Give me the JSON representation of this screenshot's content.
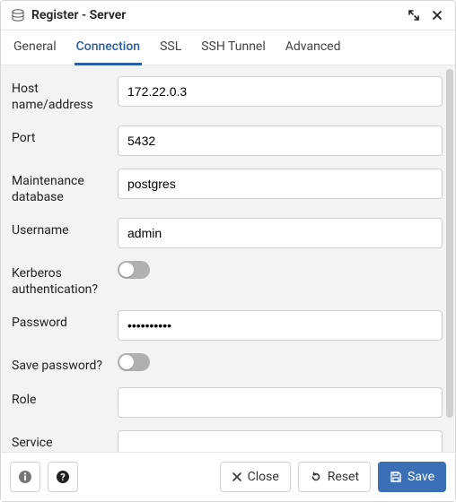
{
  "title": "Register - Server",
  "tabs": {
    "general": "General",
    "connection": "Connection",
    "ssl": "SSL",
    "ssh": "SSH Tunnel",
    "advanced": "Advanced"
  },
  "fields": {
    "host": {
      "label": "Host name/address",
      "value": "172.22.0.3"
    },
    "port": {
      "label": "Port",
      "value": "5432"
    },
    "maintdb": {
      "label": "Maintenance database",
      "value": "postgres"
    },
    "username": {
      "label": "Username",
      "value": "admin"
    },
    "kerberos": {
      "label": "Kerberos authentication?"
    },
    "password": {
      "label": "Password",
      "value": "••••••••••"
    },
    "savepw": {
      "label": "Save password?"
    },
    "role": {
      "label": "Role",
      "value": ""
    },
    "service": {
      "label": "Service",
      "value": ""
    }
  },
  "footer": {
    "close": "Close",
    "reset": "Reset",
    "save": "Save"
  }
}
